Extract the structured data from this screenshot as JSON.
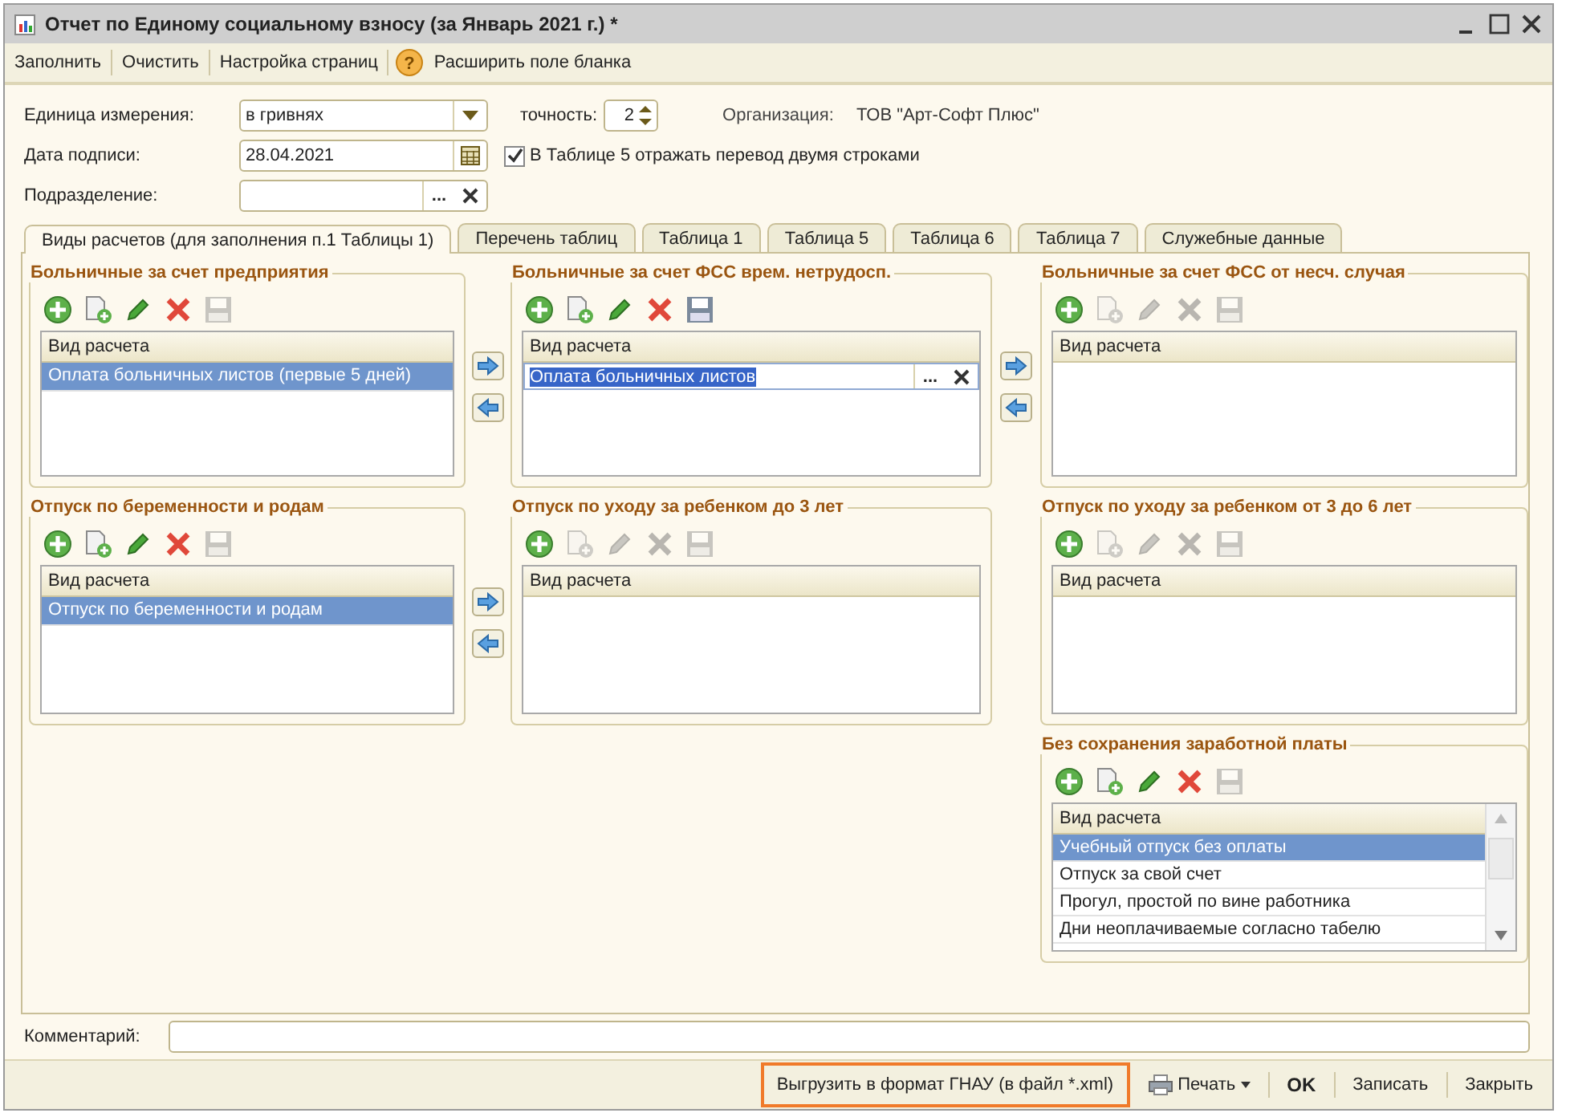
{
  "window": {
    "title": "Отчет по Единому социальному взносу (за Январь 2021 г.) *"
  },
  "toolbar": [
    {
      "kind": "text",
      "label": "Заполнить"
    },
    {
      "kind": "text",
      "label": "Очистить"
    },
    {
      "kind": "text",
      "label": "Настройка страниц"
    },
    {
      "kind": "help",
      "icon": "?",
      "label": "Расширить поле бланка"
    }
  ],
  "form": {
    "unit_label": "Единица измерения:",
    "unit_value": "в гривнях",
    "precision_label": "точность:",
    "precision_value": "2",
    "org_label": "Организация:",
    "org_value": "ТОВ \"Арт-Софт Плюс\"",
    "date_label": "Дата подписи:",
    "date_value": "28.04.2021",
    "two_lines": {
      "label": "В Таблице 5 отражать перевод двумя строками",
      "checked": true
    },
    "subdivision_label": "Подразделение:",
    "subdivision_choice": "..."
  },
  "tabs": [
    {
      "label": "Виды расчетов (для заполнения п.1 Таблицы 1)",
      "selected": true
    },
    {
      "label": "Перечень таблиц",
      "selected": false
    },
    {
      "label": "Таблица 1",
      "selected": false
    },
    {
      "label": "Таблица 5",
      "selected": false
    },
    {
      "label": "Таблица 6",
      "selected": false
    },
    {
      "label": "Таблица 7",
      "selected": false
    },
    {
      "label": "Служебные данные",
      "selected": false
    }
  ],
  "groups": [
    {
      "title": "Больничные за счет предприятия",
      "tools": [
        {
          "kind": "add",
          "disabled": false
        },
        {
          "kind": "copy",
          "disabled": false
        },
        {
          "kind": "edit",
          "disabled": false
        },
        {
          "kind": "delete",
          "disabled": false
        },
        {
          "kind": "save",
          "disabled": true
        }
      ],
      "column": "Вид расчета",
      "rows": [
        {
          "kind": "plain",
          "text": "Оплата больничных листов (первые 5 дней)",
          "selected": true
        }
      ],
      "transfer_after": true,
      "scrollbar": false
    },
    {
      "title": "Больничные за счет ФСС врем. нетрудосп.",
      "tools": [
        {
          "kind": "add",
          "disabled": false
        },
        {
          "kind": "copy",
          "disabled": false
        },
        {
          "kind": "edit",
          "disabled": false
        },
        {
          "kind": "delete",
          "disabled": false
        },
        {
          "kind": "save",
          "disabled": false
        }
      ],
      "column": "Вид расчета",
      "rows": [
        {
          "kind": "editing",
          "text": "Оплата больничных листов",
          "choice": "...",
          "selected": true
        }
      ],
      "transfer_after": true,
      "scrollbar": false
    },
    {
      "title": "Больничные за счет ФСС от несч. случая",
      "tools": [
        {
          "kind": "add",
          "disabled": false
        },
        {
          "kind": "copy",
          "disabled": true
        },
        {
          "kind": "edit",
          "disabled": true
        },
        {
          "kind": "delete",
          "disabled": true
        },
        {
          "kind": "save",
          "disabled": true
        }
      ],
      "column": "Вид расчета",
      "transfer_after": false,
      "scrollbar": false
    },
    {
      "title": "Отпуск по беременности и родам",
      "tools": [
        {
          "kind": "add",
          "disabled": false
        },
        {
          "kind": "copy",
          "disabled": false
        },
        {
          "kind": "edit",
          "disabled": false
        },
        {
          "kind": "delete",
          "disabled": false
        },
        {
          "kind": "save",
          "disabled": true
        }
      ],
      "column": "Вид расчета",
      "rows": [
        {
          "kind": "plain",
          "text": "Отпуск по беременности и родам",
          "selected": true
        }
      ],
      "transfer_after": true,
      "scrollbar": false
    },
    {
      "title": "Отпуск по уходу за ребенком до 3 лет",
      "tools": [
        {
          "kind": "add",
          "disabled": false
        },
        {
          "kind": "copy",
          "disabled": true
        },
        {
          "kind": "edit",
          "disabled": true
        },
        {
          "kind": "delete",
          "disabled": true
        },
        {
          "kind": "save",
          "disabled": true
        }
      ],
      "column": "Вид расчета",
      "transfer_after": false,
      "scrollbar": false
    },
    {
      "title": "Отпуск по уходу за ребенком от 3 до 6 лет",
      "tools": [
        {
          "kind": "add",
          "disabled": false
        },
        {
          "kind": "copy",
          "disabled": true
        },
        {
          "kind": "edit",
          "disabled": true
        },
        {
          "kind": "delete",
          "disabled": true
        },
        {
          "kind": "save",
          "disabled": true
        }
      ],
      "column": "Вид расчета",
      "transfer_after": false,
      "scrollbar": false
    },
    {
      "title": "Без сохранения заработной платы",
      "tools": [
        {
          "kind": "add",
          "disabled": false
        },
        {
          "kind": "copy",
          "disabled": false
        },
        {
          "kind": "edit",
          "disabled": false
        },
        {
          "kind": "delete",
          "disabled": false
        },
        {
          "kind": "save",
          "disabled": true
        }
      ],
      "column": "Вид расчета",
      "rows": [
        {
          "kind": "plain",
          "text": "Учебный отпуск без оплаты",
          "selected": true
        },
        {
          "kind": "plain",
          "text": "Отпуск за свой счет",
          "selected": false
        },
        {
          "kind": "plain",
          "text": "Прогул, простой по вине работника",
          "selected": false
        },
        {
          "kind": "plain",
          "text": "Дни неоплачиваемые согласно табелю",
          "selected": false
        }
      ],
      "transfer_after": false,
      "scrollbar": true
    }
  ],
  "comment": {
    "label": "Комментарий:"
  },
  "footer": [
    {
      "kind": "export",
      "label": "Выгрузить в формат ГНАУ (в файл *.xml)",
      "highlighted": true
    },
    {
      "kind": "print",
      "label": "Печать",
      "highlighted": false
    },
    {
      "kind": "ok",
      "label": "OK",
      "highlighted": false
    },
    {
      "kind": "text",
      "label": "Записать",
      "highlighted": false
    },
    {
      "kind": "text",
      "label": "Закрыть",
      "highlighted": false
    }
  ]
}
